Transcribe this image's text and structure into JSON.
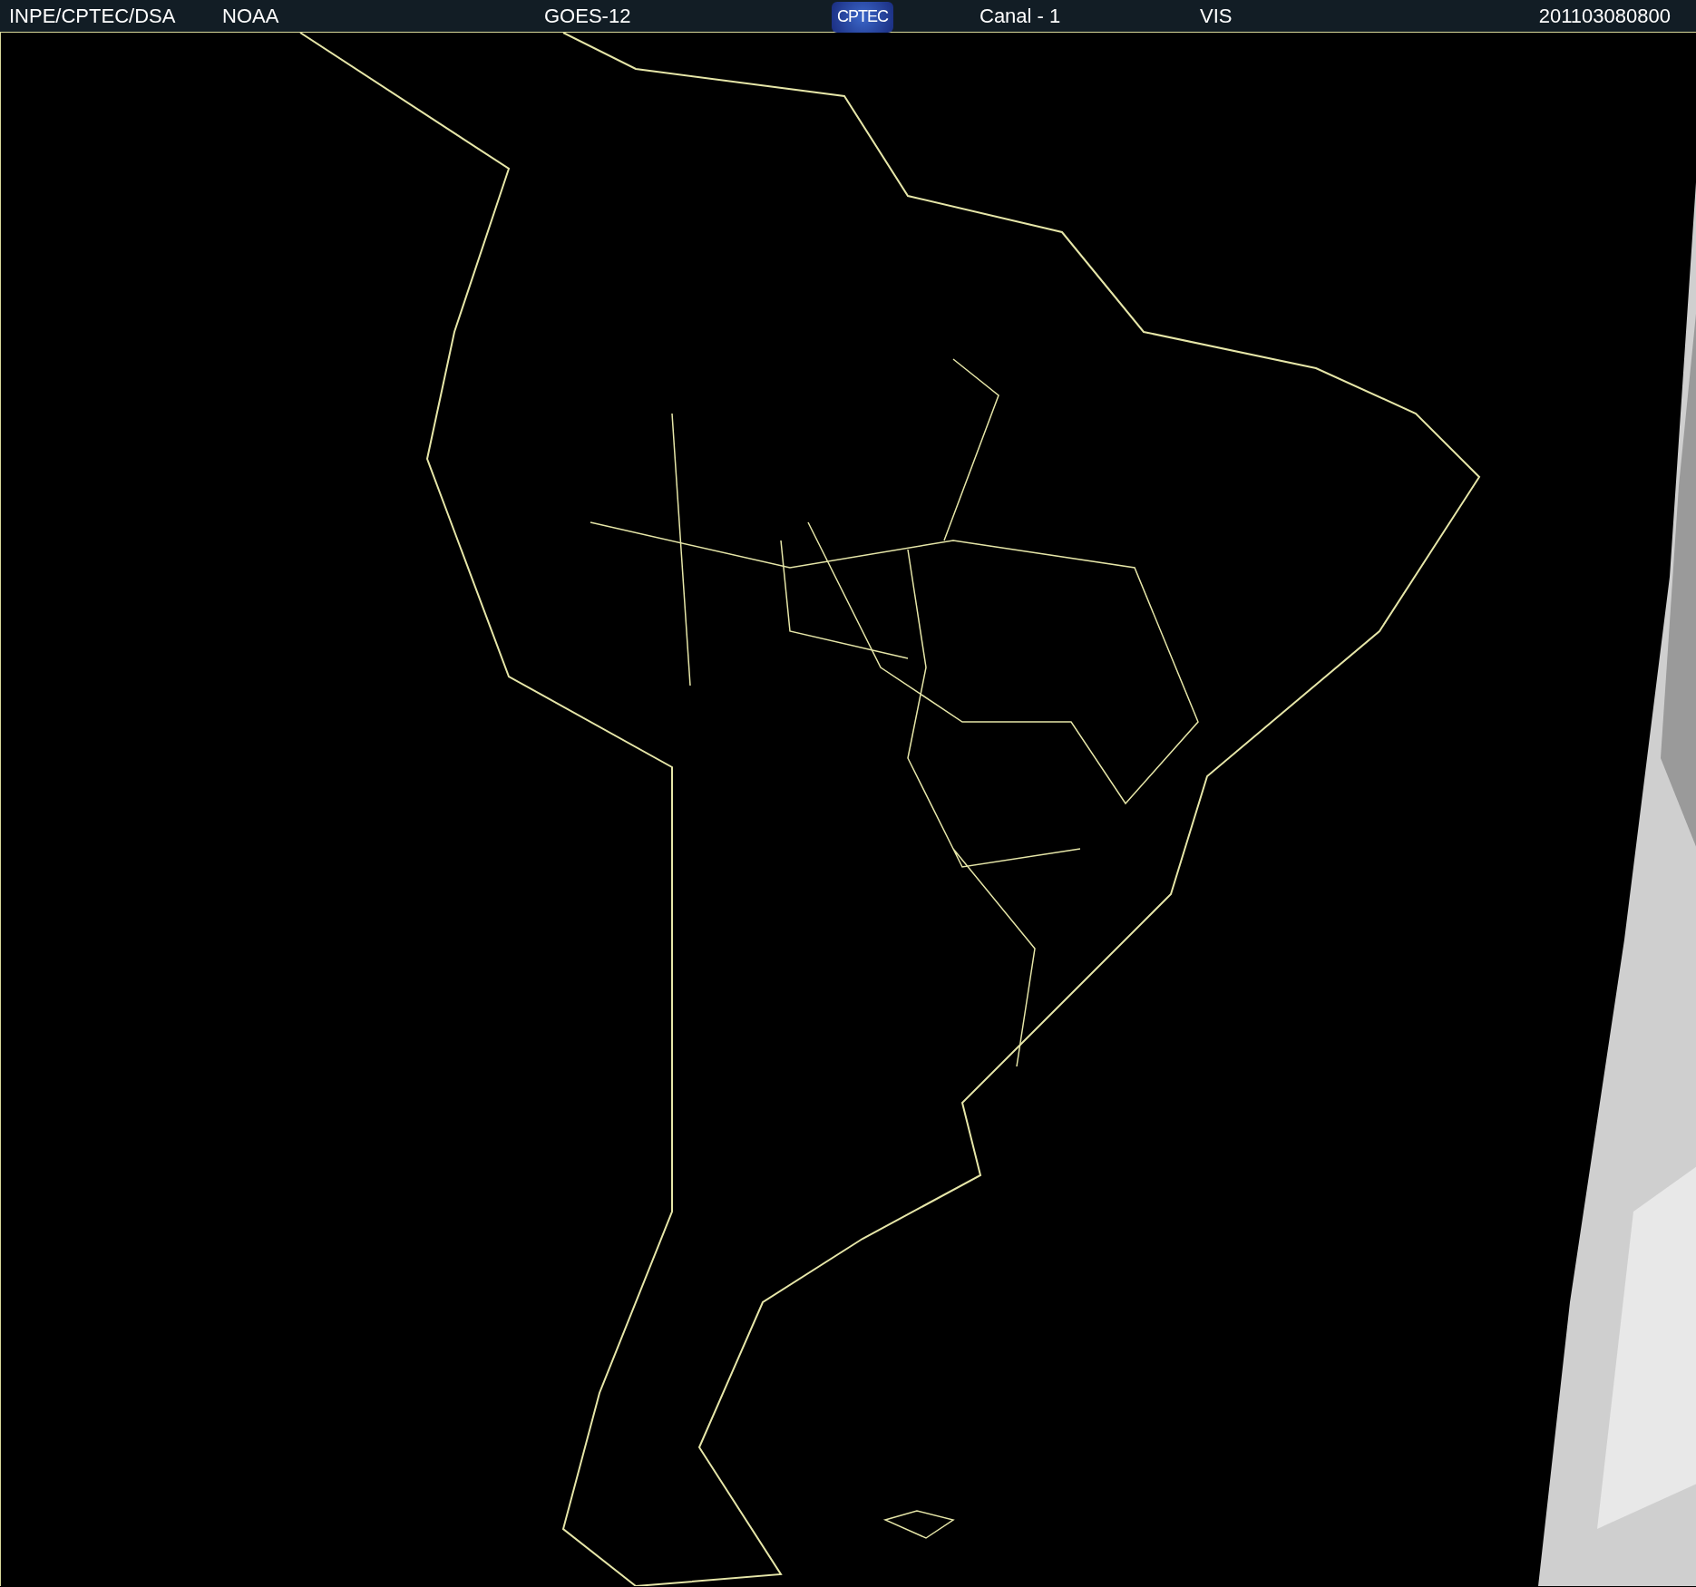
{
  "header": {
    "items": [
      {
        "kind": "text",
        "text": "INPE/CPTEC/DSA"
      },
      {
        "kind": "text",
        "text": "NOAA"
      },
      {
        "kind": "text",
        "text": "GOES-12"
      },
      {
        "kind": "logo",
        "text": "CPTEC"
      },
      {
        "kind": "text",
        "text": "Canal - 1"
      },
      {
        "kind": "text",
        "text": "VIS"
      },
      {
        "kind": "text",
        "text": "201103080800"
      }
    ]
  }
}
